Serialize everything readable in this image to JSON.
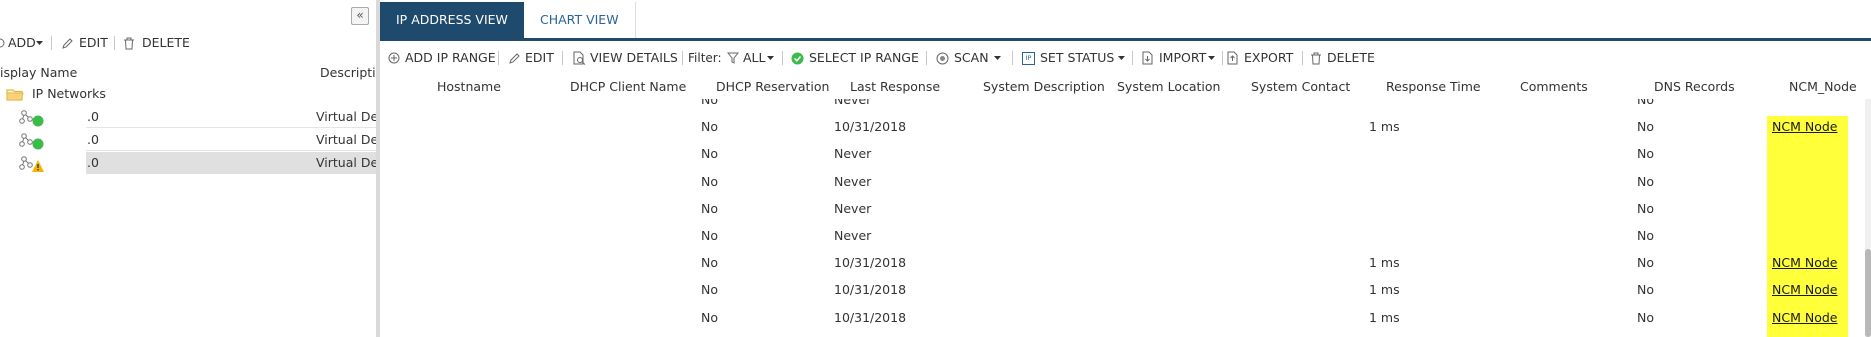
{
  "left_panel": {
    "collapse_glyph": "«",
    "toolbar": {
      "add": "ADD",
      "edit": "EDIT",
      "delete": "DELETE"
    },
    "columns": {
      "display_name": "isplay Name",
      "description": "Descripti"
    },
    "folder": {
      "label": "IP Networks",
      "icon": "folder-icon"
    },
    "rows": [
      {
        "name": ".0",
        "description": "Virtual De",
        "status": "up"
      },
      {
        "name": ".0",
        "description": "Virtual De",
        "status": "up"
      },
      {
        "name": ".0",
        "description": "Virtual De",
        "status": "warning"
      }
    ]
  },
  "tabs": [
    {
      "label": "IP ADDRESS VIEW",
      "active": true
    },
    {
      "label": "CHART VIEW",
      "active": false
    }
  ],
  "toolbar": {
    "add_ip_range": "ADD IP RANGE",
    "edit": "EDIT",
    "view_details": "VIEW DETAILS",
    "filter_label": "Filter:",
    "filter_value": "ALL",
    "select_ip_range": "SELECT IP RANGE",
    "scan": "SCAN",
    "set_status": "SET STATUS",
    "set_status_badge": "IP",
    "import": "IMPORT",
    "export": "EXPORT",
    "delete": "DELETE"
  },
  "grid": {
    "columns": [
      "Hostname",
      "DHCP Client Name",
      "DHCP Reservation",
      "Last Response",
      "System Description",
      "System Location",
      "System Contact",
      "Response Time",
      "Comments",
      "DNS Records",
      "NCM_Node"
    ],
    "rows": [
      {
        "dhcp_reservation": "No",
        "last_response": "Never",
        "response_time": "",
        "dns_records": "No",
        "ncm_node": ""
      },
      {
        "dhcp_reservation": "No",
        "last_response": "10/31/2018",
        "response_time": "1 ms",
        "dns_records": "No",
        "ncm_node": "NCM Node"
      },
      {
        "dhcp_reservation": "No",
        "last_response": "Never",
        "response_time": "",
        "dns_records": "No",
        "ncm_node": ""
      },
      {
        "dhcp_reservation": "No",
        "last_response": "Never",
        "response_time": "",
        "dns_records": "No",
        "ncm_node": ""
      },
      {
        "dhcp_reservation": "No",
        "last_response": "Never",
        "response_time": "",
        "dns_records": "No",
        "ncm_node": ""
      },
      {
        "dhcp_reservation": "No",
        "last_response": "Never",
        "response_time": "",
        "dns_records": "No",
        "ncm_node": ""
      },
      {
        "dhcp_reservation": "No",
        "last_response": "10/31/2018",
        "response_time": "1 ms",
        "dns_records": "No",
        "ncm_node": "NCM Node"
      },
      {
        "dhcp_reservation": "No",
        "last_response": "10/31/2018",
        "response_time": "1 ms",
        "dns_records": "No",
        "ncm_node": "NCM Node"
      },
      {
        "dhcp_reservation": "No",
        "last_response": "10/31/2018",
        "response_time": "1 ms",
        "dns_records": "No",
        "ncm_node": "NCM Node"
      }
    ]
  },
  "colors": {
    "accent": "#1e4a6d",
    "highlight": "#ffff3a",
    "status_up": "#3dbb4a",
    "status_warning": "#f5b400",
    "folder": "#e8b64b"
  }
}
